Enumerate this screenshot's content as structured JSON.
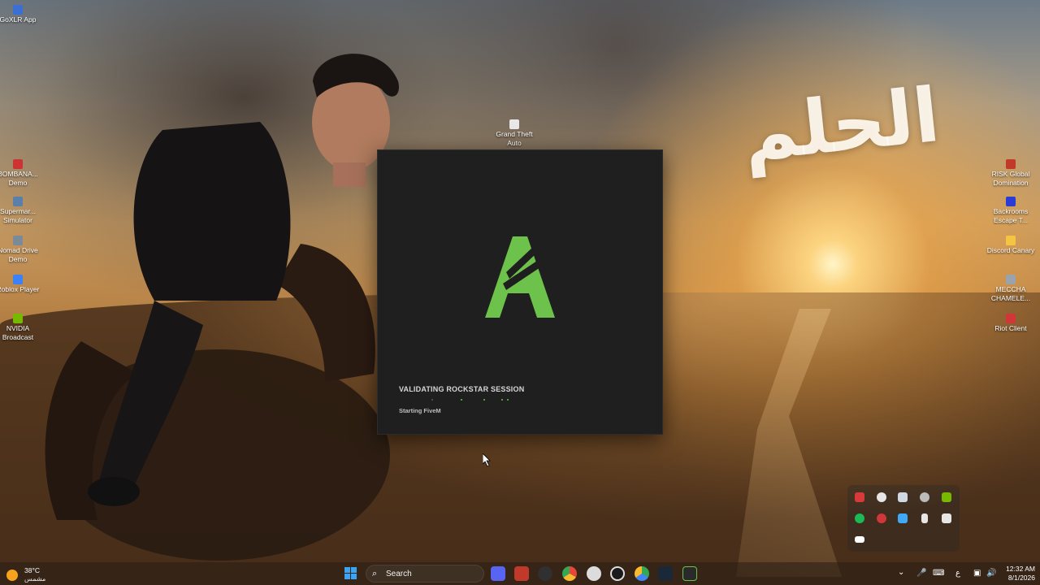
{
  "wallpaper": {
    "arabic_text": "الحلم"
  },
  "desktop_icons": [
    {
      "label": "GoXLR App",
      "color": "#3b6fd6"
    },
    {
      "label": "BOMBANA... Demo",
      "color": "#cc3333"
    },
    {
      "label": "Supermar... Simulator",
      "color": "#5a7fa8"
    },
    {
      "label": "Nomad Drive Demo",
      "color": "#7a8a99"
    },
    {
      "label": "Roblox Player",
      "color": "#3b82f6"
    },
    {
      "label": "NVIDIA Broadcast",
      "color": "#76b900"
    },
    {
      "label": "Grand Theft Auto",
      "color": "#e8e8e8"
    },
    {
      "label": "RISK Global Domination",
      "color": "#c0392b"
    },
    {
      "label": "Backrooms Escape T...",
      "color": "#2b3bd6"
    },
    {
      "label": "Discord Canary",
      "color": "#f4c542"
    },
    {
      "label": "MECCHA CHAMELE...",
      "color": "#9aa3ad"
    },
    {
      "label": "Riot Client",
      "color": "#d13639"
    }
  ],
  "launcher": {
    "status_title": "VALIDATING ROCKSTAR SESSION",
    "status_sub": "Starting FiveM",
    "accent": "#6cc24a"
  },
  "taskbar": {
    "weather_temp": "38°C",
    "weather_desc": "مشمس",
    "search_placeholder": "Search",
    "lang": "ع",
    "time": "12:32 AM",
    "date": "8/1/2026",
    "apps": [
      {
        "name": "discord-app",
        "color": "#5865f2"
      },
      {
        "name": "news-app",
        "color": "#c0392b"
      },
      {
        "name": "obs-app",
        "color": "#303030"
      },
      {
        "name": "chrome-app",
        "color": "#e8453c"
      },
      {
        "name": "settings-app",
        "color": "#dcdcdc"
      },
      {
        "name": "github-app",
        "color": "#1b1b1b"
      },
      {
        "name": "chrome-canary-app",
        "color": "#34a853"
      },
      {
        "name": "steam-app",
        "color": "#1b2838"
      },
      {
        "name": "fivem-app",
        "color": "#2a2a2a"
      }
    ]
  },
  "tray_icons": [
    {
      "name": "vpn-icon",
      "color": "#d83a3a"
    },
    {
      "name": "gear-tray-icon",
      "color": "#e6e6e6"
    },
    {
      "name": "steam-tray-icon",
      "color": "#cfd8e3"
    },
    {
      "name": "obs-tray-icon",
      "color": "#bbbbbb"
    },
    {
      "name": "nvidia-tray-icon",
      "color": "#76b900"
    },
    {
      "name": "spotify-tray-icon",
      "color": "#1db954"
    },
    {
      "name": "riot-tray-icon",
      "color": "#d13639"
    },
    {
      "name": "defender-tray-icon",
      "color": "#3fa9f5"
    },
    {
      "name": "usb-tray-icon",
      "color": "#e6e6e6"
    },
    {
      "name": "goxlr-tray-icon",
      "color": "#e6e6e6"
    },
    {
      "name": "medal-tray-icon",
      "color": "#ffffff"
    }
  ]
}
